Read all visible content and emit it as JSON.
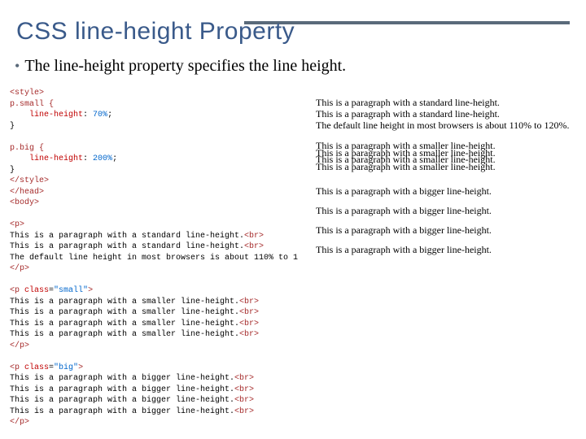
{
  "title": "CSS line-height Property",
  "bullet": "The line-height property specifies the line height.",
  "code": {
    "style_open": "<style>",
    "sel_small": "p.small {",
    "prop1_name": "line-height",
    "prop1_val": "70%",
    "close1": "}",
    "sel_big": "p.big {",
    "prop2_name": "line-height",
    "prop2_val": "200%",
    "close2": "}",
    "style_close": "</style>",
    "head_close": "</head>",
    "body_open": "<body>",
    "p_open": "<p>",
    "std1": "This is a paragraph with a standard line-height.",
    "std2": "This is a paragraph with a standard line-height.",
    "std3": "The default line height in most browsers is about 110% to 1",
    "p_close": "</p>",
    "p_small_open": "<p class=\"small\">",
    "sml1": "This is a paragraph with a smaller line-height.",
    "sml2": "This is a paragraph with a smaller line-height.",
    "sml3": "This is a paragraph with a smaller line-height.",
    "sml4": "This is a paragraph with a smaller line-height.",
    "p_big_open": "<p class=\"big\">",
    "big1": "This is a paragraph with a bigger line-height.",
    "big2": "This is a paragraph with a bigger line-height.",
    "big3": "This is a paragraph with a bigger line-height.",
    "big4": "This is a paragraph with a bigger line-height.",
    "br": "<br>"
  },
  "render": {
    "std1": "This is a paragraph with a standard line-height.",
    "std2": "This is a paragraph with a standard line-height.",
    "std3": "The default line height in most browsers is about 110% to 120%.",
    "sml1": "This is a paragraph with a smaller line-height.",
    "sml2": "This is a paragraph with a smaller line-height.",
    "sml3": "This is a paragraph with a smaller line-height.",
    "sml4": "This is a paragraph with a smaller line-height.",
    "big1": "This is a paragraph with a bigger line-height.",
    "big2": "This is a paragraph with a bigger line-height.",
    "big3": "This is a paragraph with a bigger line-height.",
    "big4": "This is a paragraph with a bigger line-height."
  }
}
